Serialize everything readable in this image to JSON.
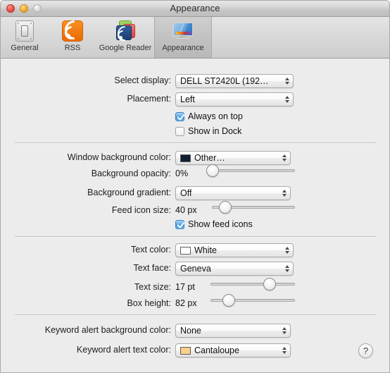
{
  "window": {
    "title": "Appearance",
    "traffic_lights": [
      "close-button",
      "minimize-button",
      "zoom-button"
    ]
  },
  "toolbar": {
    "items": [
      {
        "label": "General",
        "icon": "general-switch-icon",
        "selected": false
      },
      {
        "label": "RSS",
        "icon": "rss-icon",
        "selected": false
      },
      {
        "label": "Google Reader",
        "icon": "google-reader-icon",
        "selected": false
      },
      {
        "label": "Appearance",
        "icon": "appearance-monitor-icon",
        "selected": true
      }
    ]
  },
  "sections": {
    "display": {
      "select_display": {
        "label": "Select display:",
        "value": "DELL ST2420L (192…"
      },
      "placement": {
        "label": "Placement:",
        "value": "Left"
      },
      "always_on_top": {
        "label": "Always on top",
        "checked": true
      },
      "show_in_dock": {
        "label": "Show in Dock",
        "checked": false
      }
    },
    "background": {
      "window_background_color": {
        "label": "Window background color:",
        "value": "Other…",
        "swatch": "#101d33"
      },
      "background_opacity": {
        "label": "Background opacity:",
        "value": "0%",
        "percent": 0
      },
      "background_gradient": {
        "label": "Background gradient:",
        "value": "Off"
      },
      "feed_icon_size": {
        "label": "Feed icon size:",
        "value": "40 px",
        "percent": 16
      },
      "show_feed_icons": {
        "label": "Show feed icons",
        "checked": true
      }
    },
    "text": {
      "text_color": {
        "label": "Text color:",
        "value": "White",
        "swatch": "#ffffff"
      },
      "text_face": {
        "label": "Text face:",
        "value": "Geneva"
      },
      "text_size": {
        "label": "Text size:",
        "value": "17 pt",
        "percent": 70
      },
      "box_height": {
        "label": "Box height:",
        "value": "82 px",
        "percent": 22
      }
    },
    "keyword_alert": {
      "background_color": {
        "label": "Keyword alert background color:",
        "value": "None"
      },
      "text_color": {
        "label": "Keyword alert text color:",
        "value": "Cantaloupe",
        "swatch": "#fbd08a"
      }
    }
  },
  "help_button": {
    "label": "?"
  }
}
